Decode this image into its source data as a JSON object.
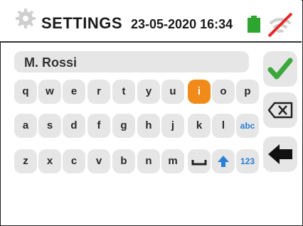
{
  "header": {
    "title": "SETTINGS",
    "datetime": "23-05-2020  16:34",
    "icons": [
      "gear-icon",
      "battery-icon",
      "wifi-off-icon"
    ],
    "colors": {
      "battery": "#2ea52e",
      "wifi_slash": "#e62828"
    }
  },
  "input": {
    "value": "M. Rossi"
  },
  "keyboard": {
    "row1": [
      "q",
      "w",
      "e",
      "r",
      "t",
      "y",
      "u",
      "i",
      "o",
      "p"
    ],
    "row2": [
      "a",
      "s",
      "d",
      "f",
      "g",
      "h",
      "j",
      "k",
      "l",
      "abc"
    ],
    "row3": [
      "z",
      "x",
      "c",
      "v",
      "b",
      "n",
      "m",
      "123"
    ],
    "active_key": "i",
    "special_icons": [
      "space-icon",
      "shift-arrow-icon"
    ]
  },
  "side_buttons": [
    "confirm-check-icon",
    "backspace-icon",
    "back-arrow-icon"
  ],
  "colors": {
    "active_key": "#f08a19",
    "check": "#3aa83a",
    "mode_text": "#2b7fd6",
    "key_bg": "#e6e6e6"
  }
}
